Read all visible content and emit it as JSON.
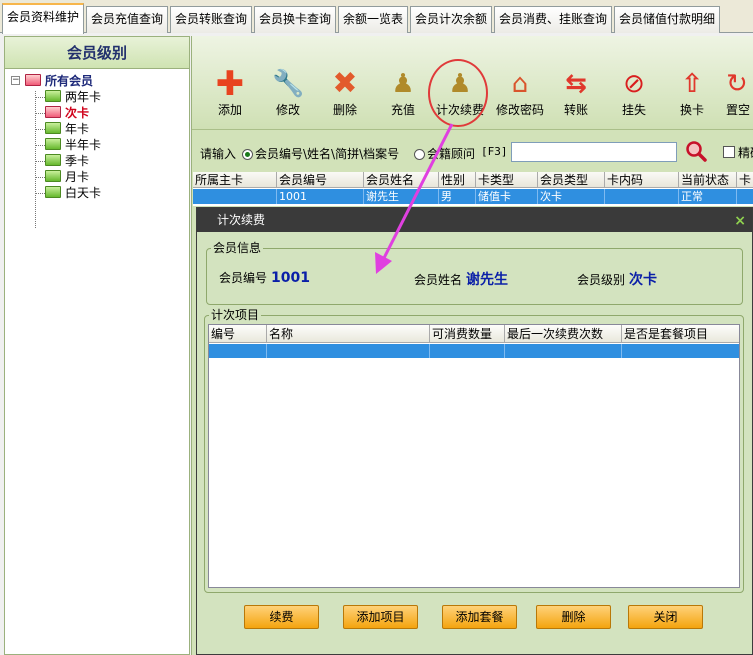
{
  "tabs": [
    "会员资料维护",
    "会员充值查询",
    "会员转账查询",
    "会员换卡查询",
    "余额一览表",
    "会员计次余额",
    "会员消费、挂账查询",
    "会员储值付款明细"
  ],
  "sidebar": {
    "title": "会员级别",
    "root": "所有会员",
    "items": [
      "两年卡",
      "次卡",
      "年卡",
      "半年卡",
      "季卡",
      "月卡",
      "白天卡"
    ],
    "selected": "次卡"
  },
  "toolbar": {
    "add": "添加",
    "edit": "修改",
    "delete": "删除",
    "recharge": "充值",
    "count_renew": "计次续费",
    "change_password": "修改密码",
    "transfer": "转账",
    "report_loss": "挂失",
    "change_card": "换卡",
    "reset": "置空"
  },
  "search": {
    "prompt": "请输入",
    "option1": "会员编号\\姓名\\简拼\\档案号",
    "option2": "会籍顾问",
    "hotkey": "[F3]",
    "exact": "精确"
  },
  "member_grid": {
    "headers": [
      "所属主卡",
      "会员编号",
      "会员姓名",
      "性别",
      "卡类型",
      "会员类型",
      "卡内码",
      "当前状态",
      "卡"
    ],
    "row": [
      "",
      "1001",
      "谢先生",
      "男",
      "储值卡",
      "次卡",
      "",
      "正常",
      ""
    ]
  },
  "dialog": {
    "title": "计次续费",
    "info_legend": "会员信息",
    "member_no_label": "会员编号",
    "member_no": "1001",
    "member_name_label": "会员姓名",
    "member_name": "谢先生",
    "member_level_label": "会员级别",
    "member_level": "次卡",
    "items_legend": "计次项目",
    "columns": [
      "编号",
      "名称",
      "可消费数量",
      "最后一次续费次数",
      "是否是套餐项目"
    ],
    "buttons": {
      "renew": "续费",
      "add_item": "添加项目",
      "add_package": "添加套餐",
      "delete": "删除",
      "close": "关闭"
    }
  },
  "colors": {
    "panel": "#d2e2b9",
    "selection": "#2f8fe0",
    "highlight_circle": "#e03a3a",
    "arrow": "#e040e0",
    "orange_button": "#f4a40f"
  }
}
